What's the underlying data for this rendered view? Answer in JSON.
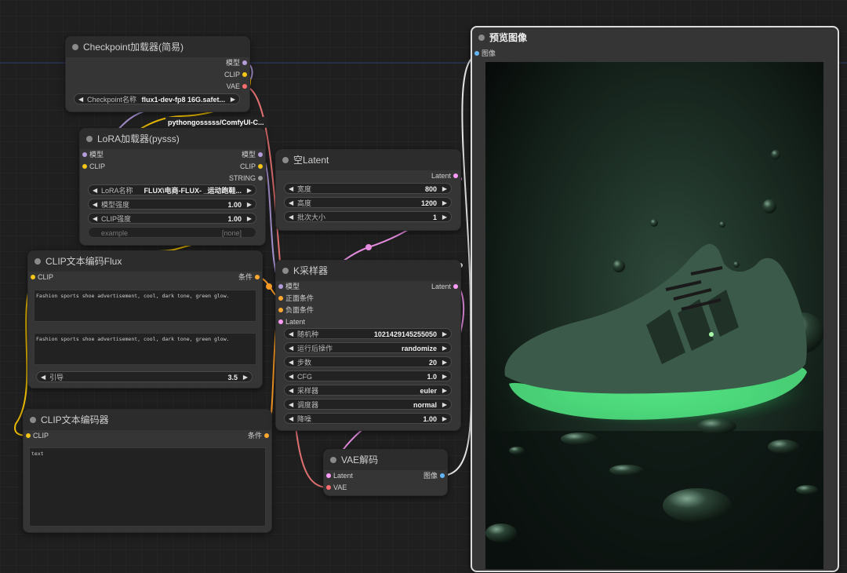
{
  "nodes": {
    "checkpoint": {
      "title": "Checkpoint加载器(简易)",
      "outputs": [
        "模型",
        "CLIP",
        "VAE"
      ],
      "widgets": [
        {
          "label": "Checkpoint名称",
          "value": "flux1-dev-fp8 16G.safet..."
        }
      ]
    },
    "lora": {
      "title": "LoRA加载器(pysss)",
      "badge": "pythongosssss/ComfyUI-C...",
      "inputs": [
        "模型",
        "CLIP"
      ],
      "outputs": [
        "模型",
        "CLIP",
        "STRING"
      ],
      "widgets": [
        {
          "label": "LoRA名称",
          "value": "FLUX\\电商-FLUX- _运动跑鞋..."
        },
        {
          "label": "模型强度",
          "value": "1.00"
        },
        {
          "label": "CLIP强度",
          "value": "1.00"
        },
        {
          "label": "example",
          "value": "[none]"
        }
      ]
    },
    "clip_flux": {
      "title": "CLIP文本编码Flux",
      "inputs": [
        "CLIP"
      ],
      "outputs": [
        "条件"
      ],
      "text1": "Fashion sports shoe advertisement, cool, dark tone, green glow.",
      "text2": "Fashion sports shoe advertisement, cool, dark tone, green glow.",
      "widgets": [
        {
          "label": "引导",
          "value": "3.5"
        }
      ]
    },
    "clip_text": {
      "title": "CLIP文本编码器",
      "inputs": [
        "CLIP"
      ],
      "outputs": [
        "条件"
      ],
      "text": "text"
    },
    "empty_latent": {
      "title": "空Latent",
      "outputs": [
        "Latent"
      ],
      "widgets": [
        {
          "label": "宽度",
          "value": "800"
        },
        {
          "label": "高度",
          "value": "1200"
        },
        {
          "label": "批次大小",
          "value": "1"
        }
      ]
    },
    "ksampler": {
      "title": "K采样器",
      "inputs": [
        "模型",
        "正面条件",
        "负面条件",
        "Latent"
      ],
      "outputs": [
        "Latent"
      ],
      "widgets": [
        {
          "label": "随机种",
          "value": "1021429145255050"
        },
        {
          "label": "运行后操作",
          "value": "randomize"
        },
        {
          "label": "步数",
          "value": "20"
        },
        {
          "label": "CFG",
          "value": "1.0"
        },
        {
          "label": "采样器",
          "value": "euler"
        },
        {
          "label": "调度器",
          "value": "normal"
        },
        {
          "label": "降噪",
          "value": "1.00"
        }
      ]
    },
    "vae_decode": {
      "title": "VAE解码",
      "inputs": [
        "Latent",
        "VAE"
      ],
      "outputs": [
        "图像"
      ]
    },
    "preview": {
      "title": "预览图像",
      "inputs": [
        "图像"
      ]
    }
  },
  "colors": {
    "model": "#b39ddb",
    "clip": "#f5c518",
    "vae": "#ff6e6e",
    "latent": "#ff9cf9",
    "conditioning": "#ffa931",
    "image": "#64b5f6"
  }
}
